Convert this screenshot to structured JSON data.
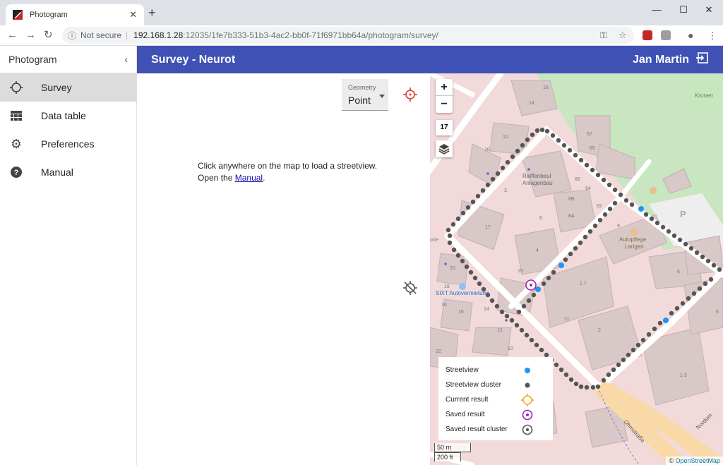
{
  "browser": {
    "tab_title": "Photogram",
    "tab_close": "✕",
    "new_tab": "+",
    "not_secure": "Not secure",
    "url_host": "192.168.1.28",
    "url_path": ":12035/1fe7b333-51b3-4ac2-bb0f-71f6971bb64a/photogram/survey/",
    "minimize": "—",
    "maximize": "☐",
    "close": "✕"
  },
  "sidebar": {
    "app_name": "Photogram",
    "collapse": "‹",
    "items": [
      {
        "label": "Survey",
        "icon": "crosshair-icon",
        "active": true
      },
      {
        "label": "Data table",
        "icon": "table-icon",
        "active": false
      },
      {
        "label": "Preferences",
        "icon": "gear-icon",
        "active": false
      },
      {
        "label": "Manual",
        "icon": "help-icon",
        "active": false
      }
    ]
  },
  "appbar": {
    "title": "Survey - Neurot",
    "user": "Jan Martin",
    "color": "#3f51b5"
  },
  "geometry_select": {
    "label": "Geometry",
    "value": "Point"
  },
  "hint": {
    "line1": "Click anywhere on the map to load a streetview.",
    "line2_prefix": "Open the ",
    "link": "Manual",
    "line2_suffix": "."
  },
  "map": {
    "zoom_in": "+",
    "zoom_out": "−",
    "zoom_level": "17",
    "labels": {
      "kronen": "Kronen",
      "raiff1": "Raiffenbeul",
      "raiff2": "Anlagenbau",
      "auto1": "Autopflege",
      "auto2": "Larigen",
      "sixt": "SIXT Autovermietung",
      "ohmstrasse": "Ohmstraße",
      "nordum": "Nordum",
      "parking": "P",
      "orte": "orte",
      "n16": "16",
      "n14": "14",
      "n12a": "12",
      "n10": "10",
      "n67": "67",
      "n65": "65",
      "n66": "66",
      "n64": "64",
      "n8b": "8B",
      "n8a": "8A",
      "n62": "62",
      "n9": "9",
      "n17": "17",
      "n6": "6",
      "n4": "4",
      "n15": "15",
      "n20": "20",
      "n18": "18",
      "n16b": "16",
      "n14b": "14",
      "n12b": "12",
      "n10b": "10",
      "n11": "11",
      "n2": "2",
      "n1_7": "1 7",
      "n13": "1 3",
      "n6b": "6",
      "n5": "5",
      "n3": "3",
      "n22": "22"
    },
    "legend": [
      {
        "label": "Streetview",
        "symbol": "streetview-dot"
      },
      {
        "label": "Streetview cluster",
        "symbol": "cluster-dot"
      },
      {
        "label": "Current result",
        "symbol": "current-result-ring"
      },
      {
        "label": "Saved result",
        "symbol": "saved-result-ring"
      },
      {
        "label": "Saved result cluster",
        "symbol": "saved-cluster-ring"
      }
    ],
    "scale_metric": "50 m",
    "scale_imperial": "200 ft",
    "attribution_prefix": "© ",
    "attribution_link": "OpenStreetMap",
    "colors": {
      "streetview": "#2196f3",
      "cluster": "#555555",
      "current": "#f5a623",
      "saved": "#9c27b0",
      "park": "#c8e6c0",
      "building": "#d8c8c8"
    }
  }
}
